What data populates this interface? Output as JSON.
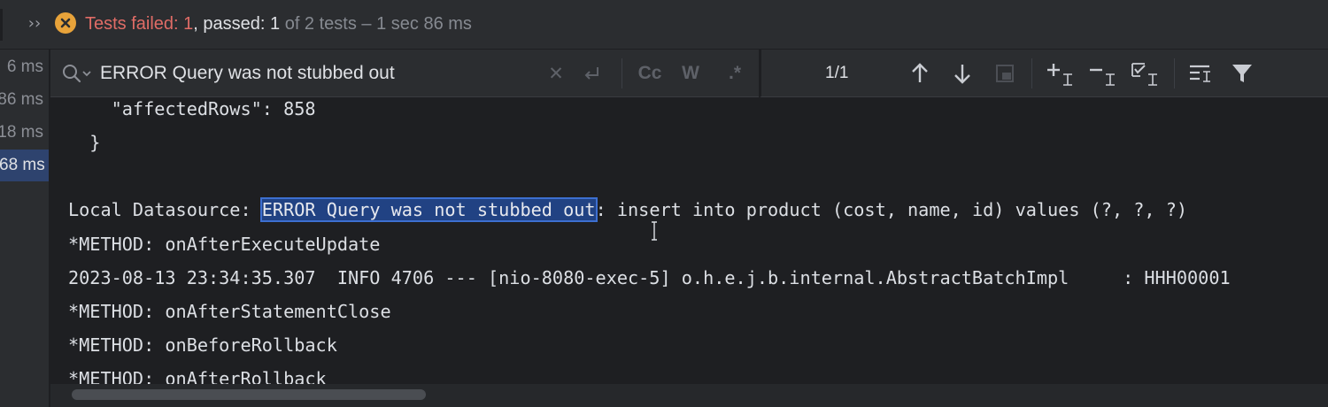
{
  "status": {
    "prefix": "Tests failed: ",
    "failed_count": "1",
    "passed_label": ", passed: ",
    "passed_count": "1",
    "suffix": " of 2 tests – 1 sec 86 ms"
  },
  "timings": [
    "6 ms",
    "86 ms",
    "18 ms",
    "68 ms"
  ],
  "selected_timing_index": 3,
  "search": {
    "value": "ERROR Query was not stubbed out",
    "match_count": "1/1",
    "case_label": "Cc",
    "word_label": "W",
    "regex_label": ".*"
  },
  "console": {
    "lines": [
      "    \"affectedRows\": 858",
      "  }",
      "",
      "",
      "*METHOD: onAfterExecuteUpdate",
      "2023-08-13 23:34:35.307  INFO 4706 --- [nio-8080-exec-5] o.h.e.j.b.internal.AbstractBatchImpl     : HHH00001",
      "*METHOD: onAfterStatementClose",
      "*METHOD: onBeforeRollback",
      "*METHOD: onAfterRollback"
    ],
    "match_line": {
      "before": "Local Datasource: ",
      "match": "ERROR Query was not stubbed out",
      "after": ": insert into product (cost, name, id) values (?, ?, ?)"
    }
  },
  "colors": {
    "failed": "#e06c66",
    "selection": "#214283",
    "background": "#1e1f22",
    "panel": "#2b2d30"
  }
}
